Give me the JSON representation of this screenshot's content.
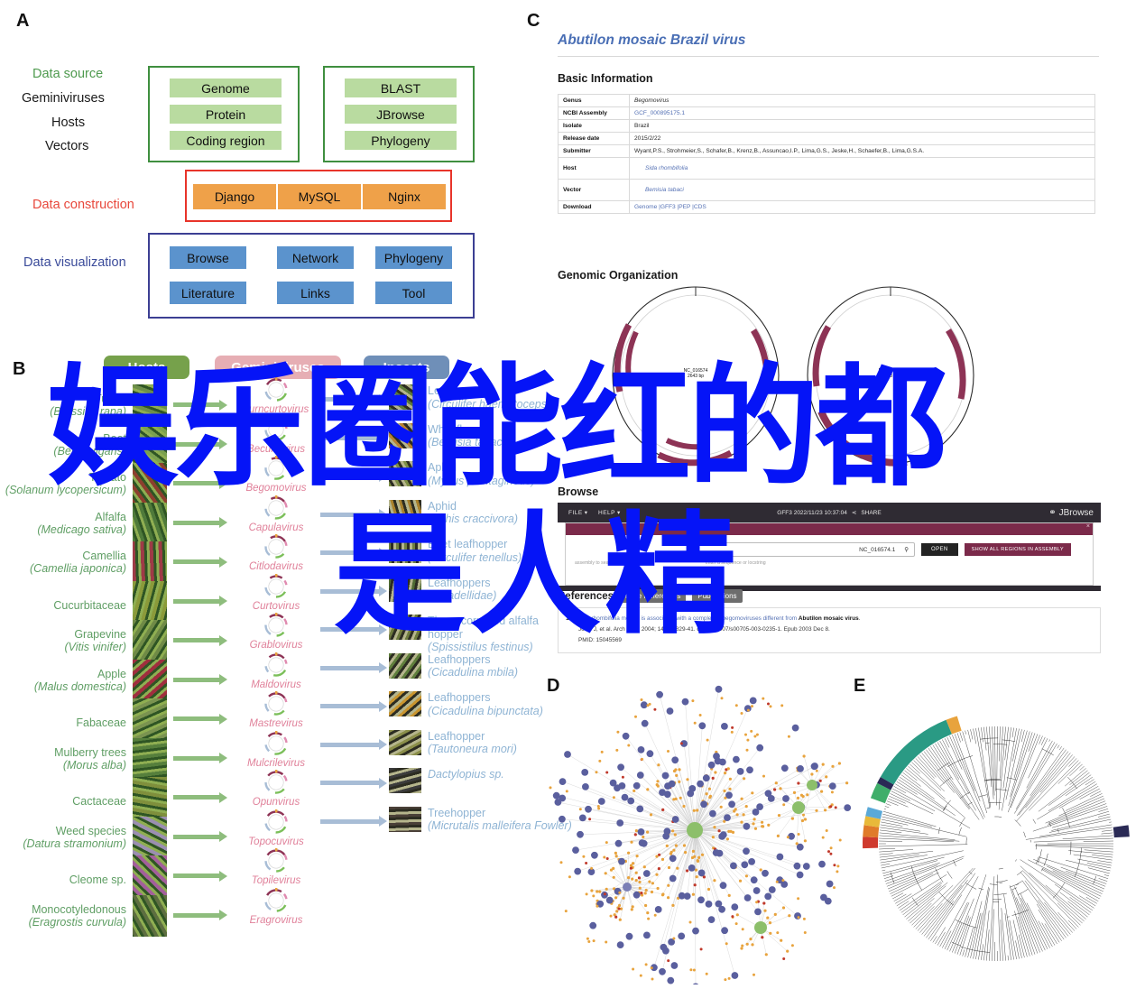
{
  "panels": {
    "a": "A",
    "b": "B",
    "c": "C",
    "d": "D",
    "e": "E"
  },
  "panelA": {
    "rows": [
      {
        "label": "Data source",
        "color": "#4e9a4e"
      },
      {
        "label": "Geminiviruses",
        "color": "#1a1a1a"
      },
      {
        "label": "Hosts",
        "color": "#1a1a1a"
      },
      {
        "label": "Vectors",
        "color": "#1a1a1a"
      },
      {
        "label": "Data construction",
        "color": "#e8483c"
      },
      {
        "label": "Data visualization",
        "color": "#3b4b9a"
      }
    ],
    "source_box_left": [
      "Genome",
      "Protein",
      "Coding region"
    ],
    "source_box_right": [
      "BLAST",
      "JBrowse",
      "Phylogeny"
    ],
    "construction": [
      "Django",
      "MySQL",
      "Nginx"
    ],
    "visualization": [
      "Browse",
      "Network",
      "Phylogeny",
      "Literature",
      "Links",
      "Tool"
    ]
  },
  "panelB": {
    "headers": {
      "hosts": "Hosts",
      "viruses": "Geminiviruses",
      "insects": "Insects"
    },
    "hosts": [
      {
        "common": "Turnip",
        "latin": "(Brassica rapa)"
      },
      {
        "common": "Beet",
        "latin": "(Beta vulgaris)"
      },
      {
        "common": "Tomato",
        "latin": "(Solanum lycopersicum)"
      },
      {
        "common": "Alfalfa",
        "latin": "(Medicago sativa)"
      },
      {
        "common": "Camellia",
        "latin": "(Camellia japonica)"
      },
      {
        "common": "Cucurbitaceae",
        "latin": ""
      },
      {
        "common": "Grapevine",
        "latin": "(Vitis vinifer)"
      },
      {
        "common": "Apple",
        "latin": "(Malus domestica)"
      },
      {
        "common": "Fabaceae",
        "latin": ""
      },
      {
        "common": "Mulberry trees",
        "latin": "(Morus alba)"
      },
      {
        "common": "Cactaceae",
        "latin": ""
      },
      {
        "common": "Weed species",
        "latin": "(Datura stramonium)"
      },
      {
        "common": "Cleome sp.",
        "latin": ""
      },
      {
        "common": "Monocotyledonous",
        "latin": "(Eragrostis curvula)"
      }
    ],
    "viruses": [
      "Turncurtovirus",
      "Becurtovirus",
      "Begomovirus",
      "Capulavirus",
      "Citlodavirus",
      "Curtovirus",
      "Grablovirus",
      "Maldovirus",
      "Mastrevirus",
      "Mulcrilevirus",
      "Opunvirus",
      "Topocuvirus",
      "Topilevirus",
      "Eragrovirus"
    ],
    "insects": [
      {
        "common": "Leafhopper",
        "latin": "(Circulifer haematoceps)"
      },
      {
        "common": "Whitefly",
        "latin": "(Bemisia tabaci)"
      },
      {
        "common": "Aphid",
        "latin": "(Myzus plantagineus)"
      },
      {
        "common": "Aphid",
        "latin": "(Aphis craccivora)"
      },
      {
        "common": "Beet leafhopper",
        "latin": "(Circulifer tenellus)"
      },
      {
        "common": "Leafhoppers",
        "latin": "(Cicadellidae)"
      },
      {
        "common": "Three-cornered alfalfa hopper",
        "latin": "(Spissistilus festinus)"
      },
      {
        "common": "Leafhoppers",
        "latin": "(Cicadulina mbila)"
      },
      {
        "common": "Leafhoppers",
        "latin": "(Cicadulina bipunctata)"
      },
      {
        "common": "Leafhopper",
        "latin": "(Tautoneura mori)"
      },
      {
        "common": "Dactylopius sp.",
        "latin": ""
      },
      {
        "common": "Treehopper",
        "latin": "(Micrutalis malleifera Fowler)"
      }
    ]
  },
  "panelC": {
    "virus_title": "Abutilon mosaic Brazil virus",
    "basic_information_heading": "Basic Information",
    "table": [
      {
        "key": "Genus",
        "value": "Begomovirus",
        "style": "italic"
      },
      {
        "key": "NCBI Assembly",
        "value": "GCF_000895175.1",
        "style": "link"
      },
      {
        "key": "Isolate",
        "value": "Brazil",
        "style": "plain"
      },
      {
        "key": "Release date",
        "value": "2015/2/22",
        "style": "plain"
      },
      {
        "key": "Submitter",
        "value": "Wyant,P.S., Strohmeier,S., Schafer,B., Krenz,B., Assuncao,I.P., Lima,G.S., Jeske,H., Schaefer,B., Lima,G.S.A.",
        "style": "plain"
      },
      {
        "key": "Host",
        "value": "Sida rhombifolia",
        "style": "hostlink"
      },
      {
        "key": "Vector",
        "value": "Bemisia tabaci",
        "style": "hostlink"
      },
      {
        "key": "Download",
        "value": "Genome |GFF3 |PEP |CDS",
        "style": "link"
      }
    ],
    "genomic_organization_heading": "Genomic Organization",
    "genomes": [
      {
        "accession": "NC_016574",
        "length": "2643 bp"
      },
      {
        "accession": "NC_016575",
        "length": "2603 bp"
      }
    ],
    "browse_heading": "Browse",
    "jbrowse": {
      "file_menu": "FILE",
      "help_menu": "HELP",
      "track_status": "GFF3 2022/11/23 10:37:04",
      "share_label": "SHARE",
      "logo_text": "JBrowse",
      "search_value": "NC_016574.1",
      "open_button": "OPEN",
      "show_all_button": "SHOW ALL REGIONS IN ASSEMBLY",
      "hint_assembly": "assembly to search",
      "hint_search": "enter a sequence or locstring",
      "close_icon": "×"
    },
    "references": {
      "heading": "References",
      "more_button": "More References",
      "publications_button": "Publications",
      "items": [
        {
          "num": "1",
          "title_pre": "Sida rhombifolia mosaic",
          "title_mid": "is associated with a complex of begomoviruses different from ",
          "title_bold": "Abutilon mosaic virus",
          "title_end": ".",
          "citation": "Jovel J, et al. Arch Virol. 2004; 149(4):829-41. doi: 10.1007/s00705-003-0235-1. Epub 2003 Dec 8.",
          "pmid": "PMID: 15045569"
        }
      ]
    }
  },
  "overlay": {
    "line1": "娱乐圈能红的都",
    "line2": "是人精",
    "color": "#0514f7"
  }
}
